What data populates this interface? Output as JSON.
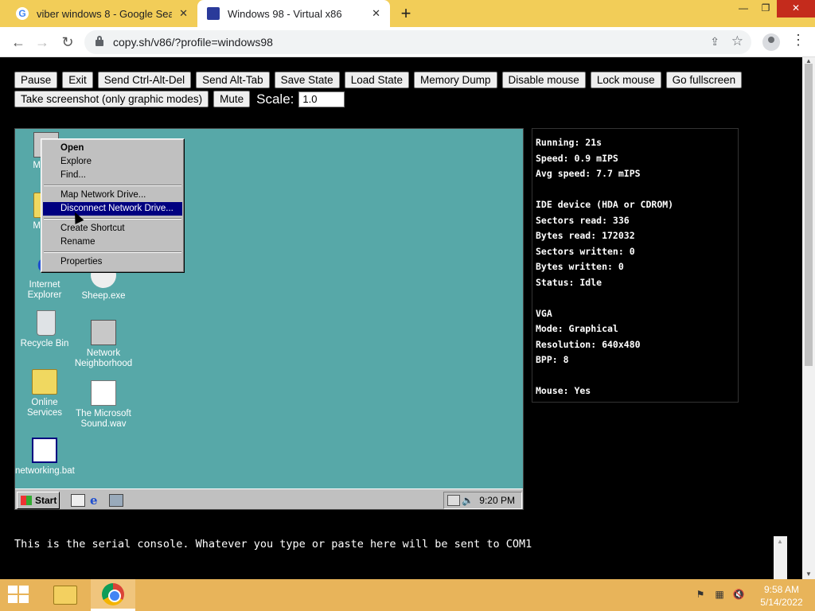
{
  "browser": {
    "tabs": [
      {
        "title": "viber windows 8 - Google Search",
        "icon": "google-icon"
      },
      {
        "title": "Windows 98 - Virtual x86",
        "icon": "v86-icon",
        "active": true
      }
    ],
    "new_tab": "+",
    "url": "copy.sh/v86/?profile=windows98",
    "window_controls": {
      "minimize": "—",
      "maximize": "❐",
      "close": "✕"
    }
  },
  "controls": {
    "row1": [
      "Pause",
      "Exit",
      "Send Ctrl-Alt-Del",
      "Send Alt-Tab",
      "Save State",
      "Load State",
      "Memory Dump",
      "Disable mouse",
      "Lock mouse",
      "Go fullscreen"
    ],
    "row2": [
      "Take screenshot (only graphic modes)",
      "Mute"
    ],
    "scale_label": "Scale:",
    "scale_value": "1.0"
  },
  "win98": {
    "desktop_icons": [
      {
        "label": "My Co",
        "icon": "my-computer-icon"
      },
      {
        "label": "My Do",
        "icon": "my-documents-icon"
      },
      {
        "label": "Internet Explorer",
        "icon": "internet-explorer-icon"
      },
      {
        "label": "Sheep.exe",
        "icon": "sheep-icon"
      },
      {
        "label": "Recycle Bin",
        "icon": "recycle-bin-icon"
      },
      {
        "label": "Network Neighborhood",
        "icon": "network-icon"
      },
      {
        "label": "Online Services",
        "icon": "folder-icon"
      },
      {
        "label": "The Microsoft Sound.wav",
        "icon": "sound-file-icon"
      },
      {
        "label": "networking.bat",
        "icon": "batch-file-icon"
      }
    ],
    "context_menu": [
      {
        "label": "Open",
        "bold": true
      },
      {
        "label": "Explore"
      },
      {
        "label": "Find..."
      },
      {
        "sep": true
      },
      {
        "label": "Map Network Drive..."
      },
      {
        "label": "Disconnect Network Drive...",
        "selected": true
      },
      {
        "sep": true
      },
      {
        "label": "Create Shortcut"
      },
      {
        "label": "Rename"
      },
      {
        "sep": true
      },
      {
        "label": "Properties"
      }
    ],
    "taskbar": {
      "start": "Start",
      "clock": "9:20 PM"
    }
  },
  "stats": {
    "running": "Running: 21s",
    "speed": "Speed: 0.9 mIPS",
    "avg_speed": "Avg speed: 7.7 mIPS",
    "ide_header": "IDE device (HDA or CDROM)",
    "sectors_read": "Sectors read: 336",
    "bytes_read": "Bytes read: 172032",
    "sectors_written": "Sectors written: 0",
    "bytes_written": "Bytes written: 0",
    "status": "Status: Idle",
    "vga_header": "VGA",
    "mode": "Mode: Graphical",
    "resolution": "Resolution: 640x480",
    "bpp": "BPP: 8",
    "mouse": "Mouse: Yes"
  },
  "serial_console": "This is the serial console. Whatever you type or paste here will be sent to COM1",
  "windows_taskbar": {
    "time": "9:58 AM",
    "date": "5/14/2022",
    "apps": [
      "file-explorer-icon",
      "chrome-icon"
    ]
  },
  "colors": {
    "chrome_tabstrip": "#f2cd58",
    "win98_desktop": "#57a8a8",
    "win98_highlight": "#000080",
    "win8_taskbar": "#e8b45a"
  }
}
